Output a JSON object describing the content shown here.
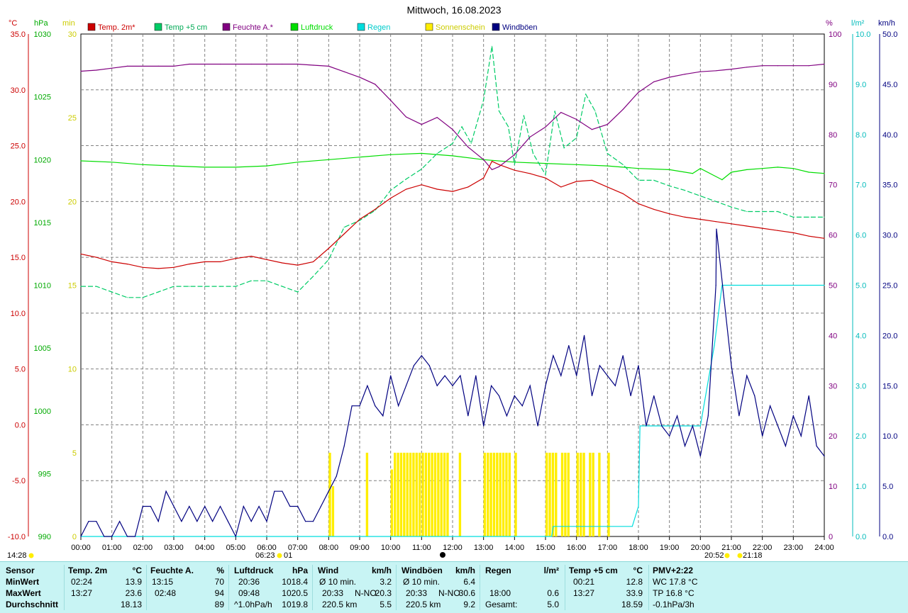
{
  "title": "Mittwoch, 16.08.2023",
  "legend": [
    {
      "label": "Temp. 2m*",
      "color": "#cc0000"
    },
    {
      "label": "Temp +5 cm",
      "color": "#00cc66"
    },
    {
      "label": "Feuchte A.*",
      "color": "#800080"
    },
    {
      "label": "Luftdruck",
      "color": "#00dd00"
    },
    {
      "label": "Regen",
      "color": "#00dddd"
    },
    {
      "label": "Sonnenschein",
      "color": "#ffee00"
    },
    {
      "label": "Windböen",
      "color": "#000080"
    }
  ],
  "axes": {
    "temp": {
      "unit": "°C",
      "color": "#cc0000",
      "ticks": [
        "35.0",
        "30.0",
        "25.0",
        "20.0",
        "15.0",
        "10.0",
        "5.0",
        "0.0",
        "-5.0",
        "-10.0"
      ],
      "min": -10,
      "max": 35
    },
    "press": {
      "unit": "hPa",
      "color": "#00aa00",
      "ticks": [
        "1030",
        "1025",
        "1020",
        "1015",
        "1010",
        "1005",
        "1000",
        "995",
        "990"
      ],
      "min": 990,
      "max": 1030
    },
    "sun": {
      "unit": "min",
      "color": "#cccc00",
      "ticks": [
        "30",
        "25",
        "20",
        "15",
        "10",
        "5",
        "0"
      ],
      "min": 0,
      "max": 30
    },
    "hum": {
      "unit": "%",
      "color": "#800080",
      "ticks": [
        "100",
        "90",
        "80",
        "70",
        "60",
        "50",
        "40",
        "30",
        "20",
        "10",
        "0"
      ],
      "min": 0,
      "max": 100
    },
    "rain": {
      "unit": "l/m²",
      "color": "#00bbbb",
      "ticks": [
        "10.0",
        "9.0",
        "8.0",
        "7.0",
        "6.0",
        "5.0",
        "4.0",
        "3.0",
        "2.0",
        "1.0",
        "0.0"
      ],
      "min": 0,
      "max": 10
    },
    "wind": {
      "unit": "km/h",
      "color": "#000080",
      "ticks": [
        "50.0",
        "45.0",
        "40.0",
        "35.0",
        "30.0",
        "25.0",
        "20.0",
        "15.0",
        "10.0",
        "5.0",
        "0.0"
      ],
      "min": 0,
      "max": 50
    }
  },
  "x_ticks": [
    "00:00",
    "01:00",
    "02:00",
    "03:00",
    "04:00",
    "05:00",
    "06:00",
    "07:00",
    "08:00",
    "09:00",
    "10:00",
    "11:00",
    "12:00",
    "13:00",
    "14:00",
    "15:00",
    "16:00",
    "17:00",
    "18:00",
    "19:00",
    "20:00",
    "21:00",
    "22:00",
    "23:00",
    "24:00"
  ],
  "annotations": {
    "moonrise": "14:28",
    "sunrise": "06:23",
    "sunrise_extra": "01",
    "moonset": "20:52",
    "sunset": "21:18"
  },
  "chart_data": {
    "type": "line",
    "x_range": [
      "00:00",
      "24:00"
    ],
    "grid": true,
    "legend_position": "top",
    "series": [
      {
        "name": "Temp. 2m*",
        "axis": "temp",
        "color": "#cc0000",
        "x": [
          0,
          0.5,
          1,
          1.5,
          2,
          2.5,
          3,
          3.5,
          4,
          4.5,
          5,
          5.5,
          6,
          6.5,
          7,
          7.5,
          8,
          8.5,
          9,
          9.5,
          10,
          10.5,
          11,
          11.5,
          12,
          12.5,
          13,
          13.27,
          13.5,
          14,
          14.5,
          15,
          15.5,
          16,
          16.5,
          17,
          17.5,
          18,
          18.5,
          19,
          19.5,
          20,
          20.5,
          21,
          21.5,
          22,
          22.5,
          23,
          23.5,
          24
        ],
        "y": [
          15.3,
          15.0,
          14.6,
          14.4,
          14.1,
          14.0,
          14.1,
          14.4,
          14.6,
          14.6,
          14.9,
          15.1,
          14.8,
          14.5,
          14.3,
          14.6,
          15.8,
          17.1,
          18.4,
          19.3,
          20.3,
          21.1,
          21.5,
          21.1,
          20.9,
          21.3,
          22.1,
          23.6,
          23.3,
          22.8,
          22.5,
          22.1,
          21.3,
          21.8,
          21.9,
          21.3,
          20.7,
          19.8,
          19.3,
          18.9,
          18.6,
          18.4,
          18.2,
          18.0,
          17.8,
          17.6,
          17.4,
          17.2,
          16.9,
          16.7
        ]
      },
      {
        "name": "Temp +5 cm",
        "axis": "temp",
        "color": "#00cc66",
        "x": [
          0,
          0.5,
          1,
          1.5,
          2,
          2.5,
          3,
          3.5,
          4,
          4.5,
          5,
          5.5,
          6,
          6.5,
          7,
          7.5,
          8,
          8.5,
          9,
          9.5,
          10,
          10.5,
          11,
          11.5,
          12,
          12.3,
          12.6,
          13,
          13.27,
          13.5,
          13.8,
          14,
          14.3,
          14.6,
          15,
          15.3,
          15.6,
          16,
          16.3,
          16.6,
          17,
          17.5,
          18,
          18.5,
          19,
          19.5,
          20,
          20.5,
          21,
          21.5,
          22,
          22.5,
          23,
          23.5,
          24
        ],
        "y": [
          12.4,
          12.4,
          11.9,
          11.4,
          11.4,
          11.9,
          12.4,
          12.4,
          12.4,
          12.4,
          12.4,
          12.9,
          12.9,
          12.4,
          11.9,
          13.3,
          14.8,
          17.7,
          18.3,
          19.2,
          21.0,
          22.0,
          22.9,
          24.3,
          25.2,
          26.7,
          25.2,
          29.1,
          33.9,
          28.1,
          26.7,
          23.3,
          27.7,
          24.3,
          22.4,
          28.1,
          24.8,
          25.7,
          29.6,
          28.1,
          24.3,
          23.3,
          21.9,
          21.9,
          21.4,
          21.0,
          20.5,
          20.0,
          19.5,
          19.1,
          19.1,
          19.1,
          18.6,
          18.6,
          18.6
        ]
      },
      {
        "name": "Feuchte A.*",
        "axis": "hum",
        "color": "#800080",
        "x": [
          0,
          0.5,
          1,
          1.5,
          2,
          2.5,
          3,
          3.5,
          4,
          4.5,
          5,
          5.5,
          6,
          6.5,
          7,
          7.5,
          8,
          8.5,
          9,
          9.5,
          10,
          10.5,
          11,
          11.5,
          12,
          12.5,
          13,
          13.27,
          13.5,
          14,
          14.5,
          15,
          15.5,
          16,
          16.5,
          17,
          17.5,
          18,
          18.5,
          19,
          19.5,
          20,
          20.5,
          21,
          21.5,
          22,
          22.5,
          23,
          23.5,
          24
        ],
        "y": [
          92.6,
          92.8,
          93.2,
          93.6,
          93.6,
          93.6,
          93.6,
          94.0,
          94.0,
          94.0,
          94.0,
          94.0,
          94.0,
          94.0,
          94.0,
          93.8,
          93.6,
          92.5,
          91.4,
          90.0,
          86.8,
          83.5,
          82.0,
          83.4,
          81.0,
          77.5,
          75.0,
          73.0,
          73.6,
          76.0,
          79.5,
          81.5,
          84.4,
          83.0,
          81.0,
          82.0,
          85.0,
          88.4,
          90.5,
          91.4,
          92.0,
          92.5,
          92.7,
          93.0,
          93.4,
          93.7,
          93.7,
          93.7,
          93.7,
          94.0
        ]
      },
      {
        "name": "Luftdruck",
        "axis": "press",
        "color": "#00dd00",
        "x": [
          0,
          1,
          2,
          3,
          4,
          5,
          6,
          7,
          8,
          9,
          10,
          11,
          12,
          13,
          14,
          15,
          16,
          17,
          18,
          19,
          19.75,
          20,
          20.7,
          21,
          21.5,
          22,
          22.5,
          23,
          23.5,
          24
        ],
        "y": [
          1019.9,
          1019.8,
          1019.6,
          1019.5,
          1019.4,
          1019.4,
          1019.5,
          1019.8,
          1020.0,
          1020.2,
          1020.4,
          1020.5,
          1020.3,
          1020.0,
          1019.8,
          1019.7,
          1019.6,
          1019.5,
          1019.3,
          1019.2,
          1018.9,
          1019.3,
          1018.4,
          1019.0,
          1019.2,
          1019.3,
          1019.4,
          1019.3,
          1019.0,
          1018.9
        ]
      },
      {
        "name": "Regen",
        "axis": "rain",
        "color": "#00dddd",
        "x": [
          0,
          15.2,
          15.25,
          17.8,
          18.0,
          18.05,
          20.0,
          20.45,
          20.7,
          24
        ],
        "y": [
          0,
          0,
          0.2,
          0.2,
          0.6,
          2.2,
          2.2,
          3.8,
          5.0,
          5.0
        ]
      },
      {
        "name": "Sonnenschein",
        "axis": "sun",
        "color": "#ffee00",
        "type": "bar",
        "x": [
          8.0,
          8.1,
          9.2,
          10.0,
          10.1,
          10.2,
          10.3,
          10.4,
          10.5,
          10.6,
          10.7,
          10.8,
          10.9,
          11.0,
          11.1,
          11.2,
          11.3,
          11.4,
          11.5,
          11.6,
          11.7,
          11.8,
          12.2,
          13.0,
          13.1,
          13.2,
          13.3,
          13.4,
          13.5,
          13.6,
          13.7,
          13.8,
          14.0,
          15.0,
          15.1,
          15.2,
          15.3,
          15.5,
          15.6,
          15.7,
          16.0,
          16.1,
          16.2,
          16.4,
          16.5,
          16.7,
          17.0
        ],
        "y": [
          5,
          3,
          5,
          4,
          5,
          5,
          5,
          5,
          5,
          5,
          5,
          5,
          5,
          5,
          5,
          5,
          5,
          5,
          5,
          5,
          5,
          5,
          5,
          5,
          5,
          5,
          5,
          5,
          5,
          5,
          5,
          5,
          5,
          5,
          5,
          5,
          5,
          5,
          5,
          5,
          5,
          5,
          5,
          5,
          5,
          5,
          5
        ]
      },
      {
        "name": "Windböen",
        "axis": "wind",
        "color": "#000080",
        "x": [
          0,
          0.25,
          0.5,
          0.75,
          1,
          1.25,
          1.5,
          1.75,
          2,
          2.25,
          2.5,
          2.75,
          3,
          3.25,
          3.5,
          3.75,
          4,
          4.25,
          4.5,
          4.75,
          5,
          5.25,
          5.5,
          5.75,
          6,
          6.25,
          6.5,
          6.75,
          7,
          7.25,
          7.5,
          7.75,
          8,
          8.25,
          8.5,
          8.75,
          9,
          9.25,
          9.5,
          9.75,
          10,
          10.25,
          10.5,
          10.75,
          11,
          11.25,
          11.5,
          11.75,
          12,
          12.25,
          12.5,
          12.75,
          13,
          13.25,
          13.5,
          13.75,
          14,
          14.25,
          14.5,
          14.75,
          15,
          15.25,
          15.5,
          15.75,
          16,
          16.25,
          16.5,
          16.75,
          17,
          17.25,
          17.5,
          17.75,
          18,
          18.25,
          18.5,
          18.75,
          19,
          19.25,
          19.5,
          19.75,
          20,
          20.25,
          20.5,
          20.52,
          20.75,
          21,
          21.25,
          21.5,
          21.75,
          22,
          22.25,
          22.5,
          22.75,
          23,
          23.25,
          23.5,
          23.75,
          24
        ],
        "y": [
          0,
          1.5,
          1.5,
          0,
          0,
          1.5,
          0,
          0,
          3,
          3,
          1.5,
          4.5,
          3,
          1.5,
          3,
          1.5,
          3,
          1.5,
          3,
          1.5,
          0,
          3,
          1.5,
          3,
          1.5,
          4.5,
          4.5,
          3,
          3,
          1.5,
          1.5,
          3,
          4.5,
          6,
          9,
          13,
          13,
          15,
          13,
          12,
          16,
          13,
          15,
          17,
          18,
          17,
          15,
          16,
          15,
          16,
          12,
          16,
          11,
          15,
          14,
          12,
          14,
          13,
          15,
          11,
          15,
          18,
          16,
          19,
          16,
          20,
          14,
          17,
          16,
          15,
          18,
          14,
          17,
          11,
          14,
          11,
          10,
          12,
          9,
          11,
          8,
          12,
          25,
          30.6,
          24,
          17,
          12,
          16,
          14,
          10,
          13,
          11,
          9,
          12,
          10,
          14,
          9,
          8
        ]
      }
    ]
  },
  "table": {
    "sensor": {
      "header": "Sensor",
      "rows": [
        "MinWert",
        "MaxWert",
        "Durchschnitt"
      ]
    },
    "temp2m": {
      "header": "Temp. 2m",
      "unit": "°C",
      "rows": [
        [
          "02:24",
          "13.9"
        ],
        [
          "13:27",
          "23.6"
        ],
        [
          "",
          "18.13"
        ]
      ]
    },
    "feuchte": {
      "header": "Feuchte A.",
      "unit": "%",
      "rows": [
        [
          "13:15",
          "70"
        ],
        [
          "02:48",
          "94"
        ],
        [
          "",
          "89"
        ]
      ]
    },
    "luftdruck": {
      "header": "Luftdruck",
      "unit": "hPa",
      "rows": [
        [
          "20:36",
          "1018.4"
        ],
        [
          "09:48",
          "1020.5"
        ],
        [
          "^1.0hPa/h",
          "1019.8"
        ]
      ]
    },
    "wind": {
      "header": "Wind",
      "unit": "km/h",
      "rows": [
        [
          "Ø 10 min.",
          "",
          "3.2"
        ],
        [
          "20:33",
          "N-NO",
          "20.3"
        ],
        [
          "220.5 km",
          "",
          "5.5"
        ]
      ]
    },
    "windboeen": {
      "header": "Windböen",
      "unit": "km/h",
      "rows": [
        [
          "Ø 10 min.",
          "",
          "6.4"
        ],
        [
          "20:33",
          "N-NO",
          "30.6"
        ],
        [
          "220.5 km",
          "",
          "9.2"
        ]
      ]
    },
    "regen": {
      "header": "Regen",
      "unit": "l/m²",
      "rows": [
        [
          "",
          ""
        ],
        [
          "18:00",
          "0.6"
        ],
        [
          "Gesamt:",
          "5.0"
        ]
      ]
    },
    "temp5cm": {
      "header": "Temp +5 cm",
      "unit": "°C",
      "rows": [
        [
          "00:21",
          "12.8"
        ],
        [
          "13:27",
          "33.9"
        ],
        [
          "",
          "18.59"
        ]
      ]
    },
    "pmv": {
      "header": "PMV+2:22",
      "rows": [
        "WC 17.8 °C",
        "TP 16.8 °C",
        "-0.1hPa/3h"
      ]
    }
  }
}
